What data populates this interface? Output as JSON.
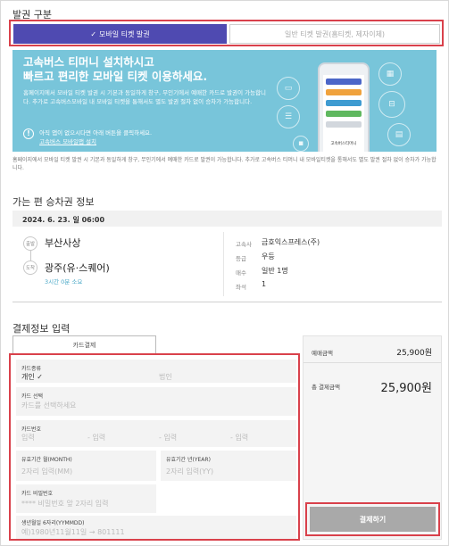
{
  "section1": {
    "title": "발권 구분",
    "mobile_btn": "모바일 티켓 발권",
    "paper_btn": "일반 티켓 발권(홈티켓, 제자이체)"
  },
  "banner": {
    "headline1": "고속버스 티머니 설치하시고",
    "headline2": "빠르고 편리한 모바일 티켓 이용하세요.",
    "desc": "홈페이지에서 모바일 티켓 발권 시 기본과 동일하게 창구, 무인기에서 예매한 카드로 발권이 가능합니다. 추가로 고속버스모바일 내 모바일 티켓을 통해서도 별도 발권 절차 없이 승차가 가능합니다.",
    "notice": "아직 앱이 없으시다면 아래 버튼을 클릭하세요.",
    "link": "고속버스 모바일앱 설치",
    "phone_label": "고속버스티머니"
  },
  "footnote": "홈페이지에서 모바일 티켓 발권 시 기본과 동일하게 창구, 무인기에서 예매한 카드로 발권이 가능합니다. 추가로 고속버스 티머니 내 모바일티켓을 통해서도 별도 발권 절차 없이 승차가 가능합니다.",
  "section2": {
    "title": "가는 편 승차권 정보",
    "date_time": "2024. 6. 23. 일 06:00",
    "dep_badge": "출발",
    "arr_badge": "도착",
    "departure": "부산사상",
    "arrival": "광주(유·스퀘어)",
    "duration": "3시간 0분 소요",
    "details": [
      {
        "label": "고속사",
        "value": "금호익스프레스(주)"
      },
      {
        "label": "등급",
        "value": "우등"
      },
      {
        "label": "매수",
        "value": "일반 1명"
      },
      {
        "label": "좌석",
        "value": "1"
      }
    ]
  },
  "section3": {
    "title": "결제정보 입력",
    "tab": "카드결제",
    "card_type_label": "카드종류",
    "card_type_personal": "개인 ✓",
    "card_type_corp": "법인",
    "card_select_label": "카드 선택",
    "card_select_placeholder": "카드를 선택하세요",
    "card_num_label": "카드번호",
    "card_num_placeholder": "입력",
    "exp_month_label": "유효기간 월(MONTH)",
    "exp_month_placeholder": "2자리 입력(MM)",
    "exp_year_label": "유효기간 년(YEAR)",
    "exp_year_placeholder": "2자리 입력(YY)",
    "pw_label": "카드 비밀번호",
    "pw_placeholder": "**** 비밀번호 앞 2자리 입력",
    "birth_label": "생년월일 6자리(YYMMDD)",
    "birth_placeholder": "예)1980년11월11일 → 801111"
  },
  "summary": {
    "price_label": "예매금액",
    "price_value": "25,900원",
    "total_label": "총 결제금액",
    "total_value": "25,900원",
    "pay_btn": "결제하기"
  }
}
